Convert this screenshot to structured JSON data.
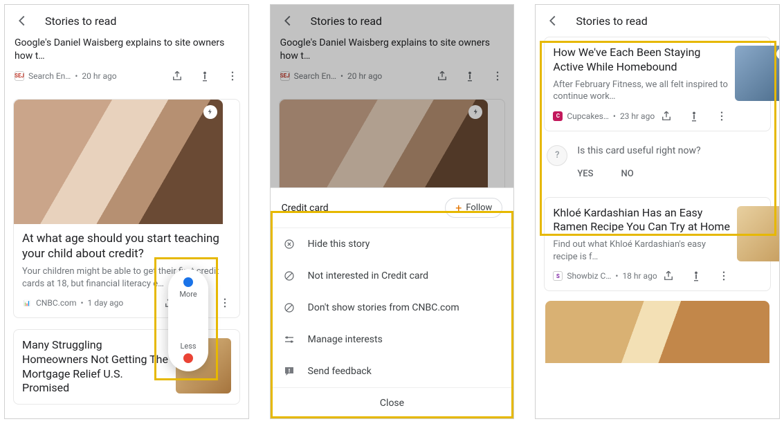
{
  "screen1": {
    "title": "Stories to read",
    "top_snippet": "Google's Daniel Waisberg explains to site owners how t…",
    "top_source": "Search En…",
    "top_time": "20 hr ago",
    "top_favicon": "SEJ",
    "card2_headline": "At what age should you start teaching your child about credit?",
    "card2_sub": "Your children might be able to get their first credit cards at 18, but financial literacy e…",
    "card2_source": "CNBC.com",
    "card2_time": "1 day ago",
    "card3_headline": "Many Struggling Homeowners Not Getting The Mortgage Relief U.S. Promised",
    "popover_more": "More",
    "popover_less": "Less"
  },
  "screen2": {
    "title": "Stories to read",
    "top_snippet": "Google's Daniel Waisberg explains to site owners how t…",
    "top_source": "Search En…",
    "top_time": "20 hr ago",
    "top_favicon": "SEJ",
    "sheet_topic": "Credit card",
    "follow": "Follow",
    "item1": "Hide this story",
    "item2": "Not interested in Credit card",
    "item3": "Don't show stories from CNBC.com",
    "item4": "Manage interests",
    "item5": "Send feedback",
    "close": "Close"
  },
  "screen3": {
    "title": "Stories to read",
    "card1_headline": "How We've Each Been Staying Active While Homebound",
    "card1_sub": "After February Fitness, we all felt inspired to continue work…",
    "card1_source": "Cupcakes…",
    "card1_time": "23 hr ago",
    "useful_q": "Is this card useful right now?",
    "yes": "YES",
    "no": "NO",
    "card2_headline": "Khloé Kardashian Has an Easy Ramen Recipe You Can Try at Home",
    "card2_sub": "Find out what Khloé Kardashian's easy recipe is f…",
    "card2_source": "Showbiz C…",
    "card2_time": "18 hr ago"
  }
}
